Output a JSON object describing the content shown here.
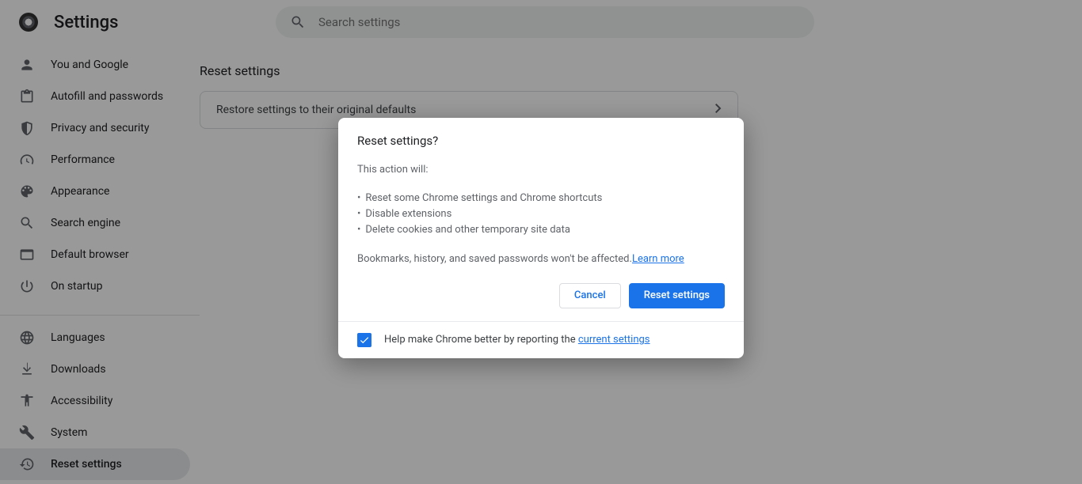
{
  "header": {
    "title": "Settings",
    "search_placeholder": "Search settings"
  },
  "sidebar": {
    "items": [
      {
        "id": "you-and-google",
        "label": "You and Google",
        "icon": "person"
      },
      {
        "id": "autofill",
        "label": "Autofill and passwords",
        "icon": "clipboard"
      },
      {
        "id": "privacy",
        "label": "Privacy and security",
        "icon": "shield"
      },
      {
        "id": "performance",
        "label": "Performance",
        "icon": "speedometer"
      },
      {
        "id": "appearance",
        "label": "Appearance",
        "icon": "palette"
      },
      {
        "id": "search-engine",
        "label": "Search engine",
        "icon": "search"
      },
      {
        "id": "default-browser",
        "label": "Default browser",
        "icon": "browser"
      },
      {
        "id": "on-startup",
        "label": "On startup",
        "icon": "power"
      }
    ],
    "items2": [
      {
        "id": "languages",
        "label": "Languages",
        "icon": "globe"
      },
      {
        "id": "downloads",
        "label": "Downloads",
        "icon": "download"
      },
      {
        "id": "accessibility",
        "label": "Accessibility",
        "icon": "accessibility"
      },
      {
        "id": "system",
        "label": "System",
        "icon": "wrench"
      },
      {
        "id": "reset-settings",
        "label": "Reset settings",
        "icon": "history",
        "active": true
      }
    ]
  },
  "main": {
    "section_title": "Reset settings",
    "row_label": "Restore settings to their original defaults"
  },
  "dialog": {
    "title": "Reset settings?",
    "lead": "This action will:",
    "bullets": [
      "Reset some Chrome settings and Chrome shortcuts",
      "Disable extensions",
      "Delete cookies and other temporary site data"
    ],
    "footer_note_prefix": "Bookmarks, history, and saved passwords won't be affected.",
    "learn_more": "Learn more",
    "cancel_label": "Cancel",
    "confirm_label": "Reset settings",
    "report_prefix": "Help make Chrome better by reporting the ",
    "report_link": "current settings",
    "report_checked": true
  }
}
